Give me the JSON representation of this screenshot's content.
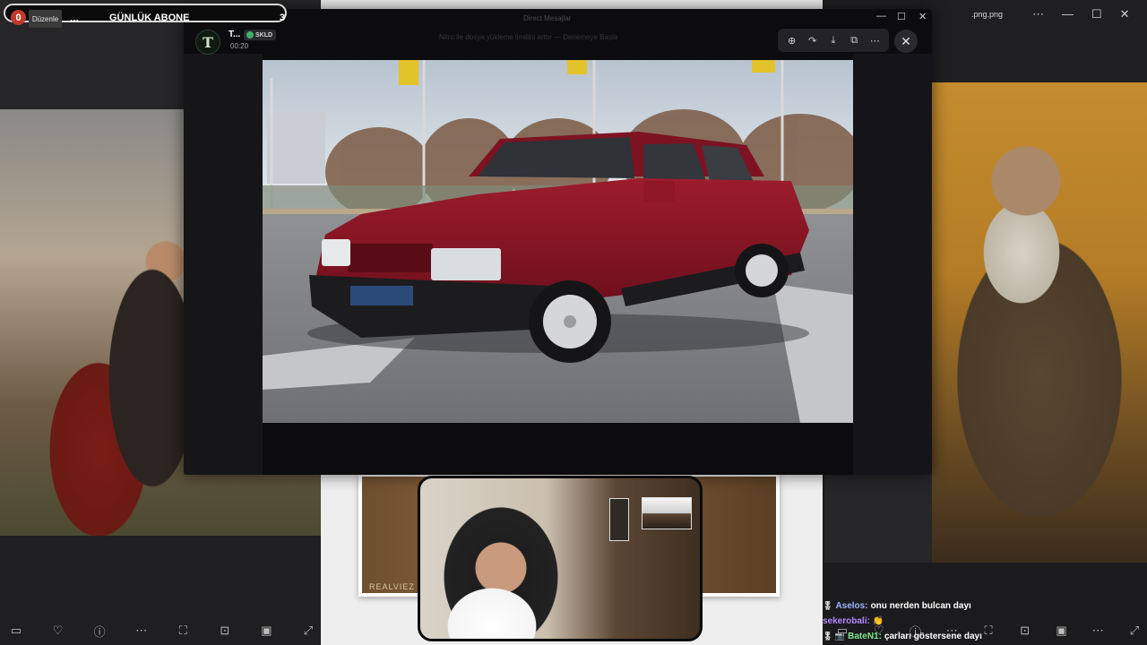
{
  "overlay": {
    "sub_zero": "0",
    "edit_label": "Düzenle",
    "dots": "...",
    "title": "GÜNLÜK ABONE",
    "count": "3"
  },
  "background": {
    "right_filename": ".png.png",
    "framed_watermark": "REALVIEZ"
  },
  "viewer": {
    "avatar_letter": "T",
    "sender": "T...",
    "tag": "SKLD",
    "time": "00:20",
    "ghost_title": "Direct Mesajlar",
    "ghost_banner": "Nitro ile dosya yükleme limitini arttır — Denemeye Başla",
    "actions": [
      "zoom-in-icon",
      "forward-icon",
      "download-icon",
      "open-external-icon",
      "more-icon"
    ],
    "close_icon": "close-icon"
  },
  "chat": [
    {
      "badge": "🎖",
      "user": "Aselos:",
      "user_color": "#9ab6ff",
      "msg": "onu nerden bulcan dayı"
    },
    {
      "badge": "",
      "user": "sekerobali:",
      "user_color": "#b388ff",
      "msg": "👏"
    },
    {
      "badge": "🎖 📷",
      "user": "BateN1:",
      "user_color": "#7fe88f",
      "msg": "çarları göstersene dayı"
    }
  ],
  "colors": {
    "accent_red": "#c0392b",
    "car_red": "#8b1424",
    "viewer_bg": "#0c0c0e"
  }
}
